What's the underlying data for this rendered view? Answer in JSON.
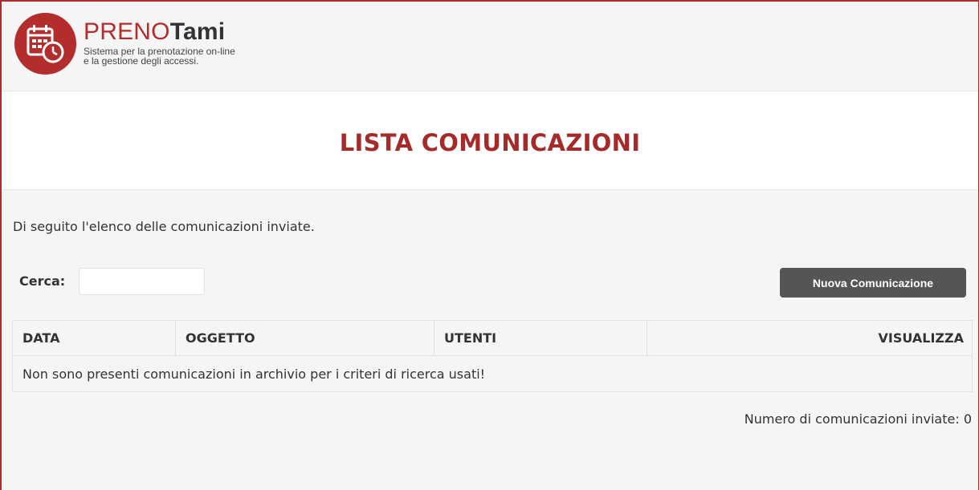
{
  "app": {
    "brand_pre": "PRENO",
    "brand_tami": "Tami",
    "tagline_line1": "Sistema per la prenotazione on-line",
    "tagline_line2": "e la gestione degli accessi."
  },
  "page": {
    "title": "LISTA COMUNICAZIONI",
    "intro": "Di seguito l'elenco delle comunicazioni inviate."
  },
  "search": {
    "label": "Cerca:",
    "value": "",
    "placeholder": ""
  },
  "toolbar": {
    "new_label": "Nuova Comunicazione"
  },
  "table": {
    "columns": [
      "DATA",
      "OGGETTO",
      "UTENTI",
      "VISUALIZZA"
    ],
    "empty_message": "Non sono presenti comunicazioni in archivio per i criteri di ricerca usati!"
  },
  "footer": {
    "count_text": "Numero di comunicazioni inviate: 0"
  },
  "icons": {
    "logo": "calendar-clock-icon"
  },
  "colors": {
    "accent": "#b32d2d",
    "title": "#a52a2a",
    "button": "#555555"
  }
}
